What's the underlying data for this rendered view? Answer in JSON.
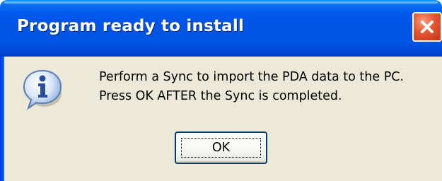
{
  "dialog": {
    "title": "Program ready to install",
    "icon": "information-icon",
    "message_lines": [
      "Perform a Sync to import the PDA data to the PC.",
      "Press OK AFTER the Sync is completed."
    ],
    "ok_label": "OK"
  },
  "titlebar": {
    "close_icon": "close-icon"
  },
  "colors": {
    "titlebar": "#0054e3",
    "close_button": "#e5562f",
    "client_background": "#ece9d8",
    "button_border": "#003c74"
  }
}
